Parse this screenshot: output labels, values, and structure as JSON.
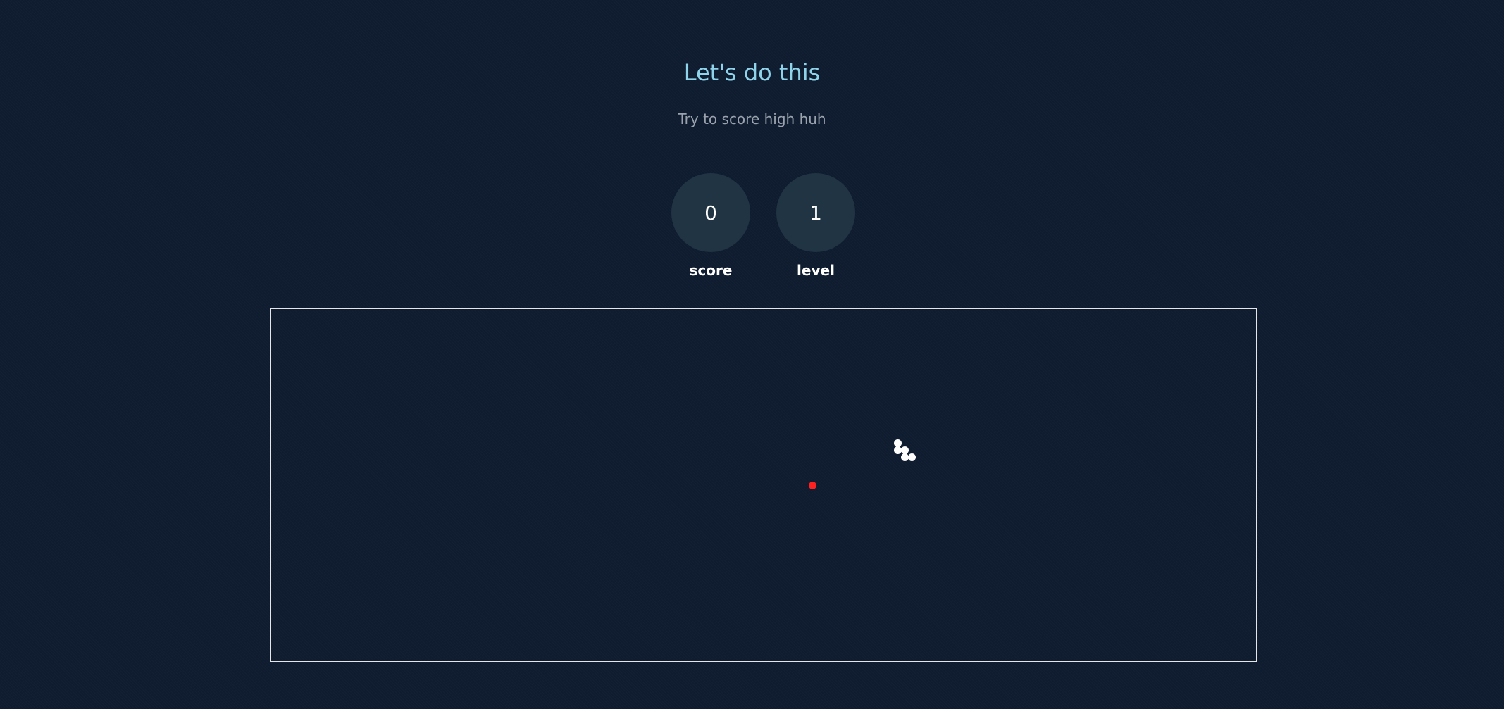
{
  "header": {
    "title": "Let's do this",
    "subtitle": "Try to score high huh"
  },
  "stats": [
    {
      "label": "score",
      "value": "0"
    },
    {
      "label": "level",
      "value": "1"
    }
  ],
  "game": {
    "snake_color": "#ffffff",
    "food_color": "#ff2020",
    "border_color": "#e6e6e6"
  }
}
